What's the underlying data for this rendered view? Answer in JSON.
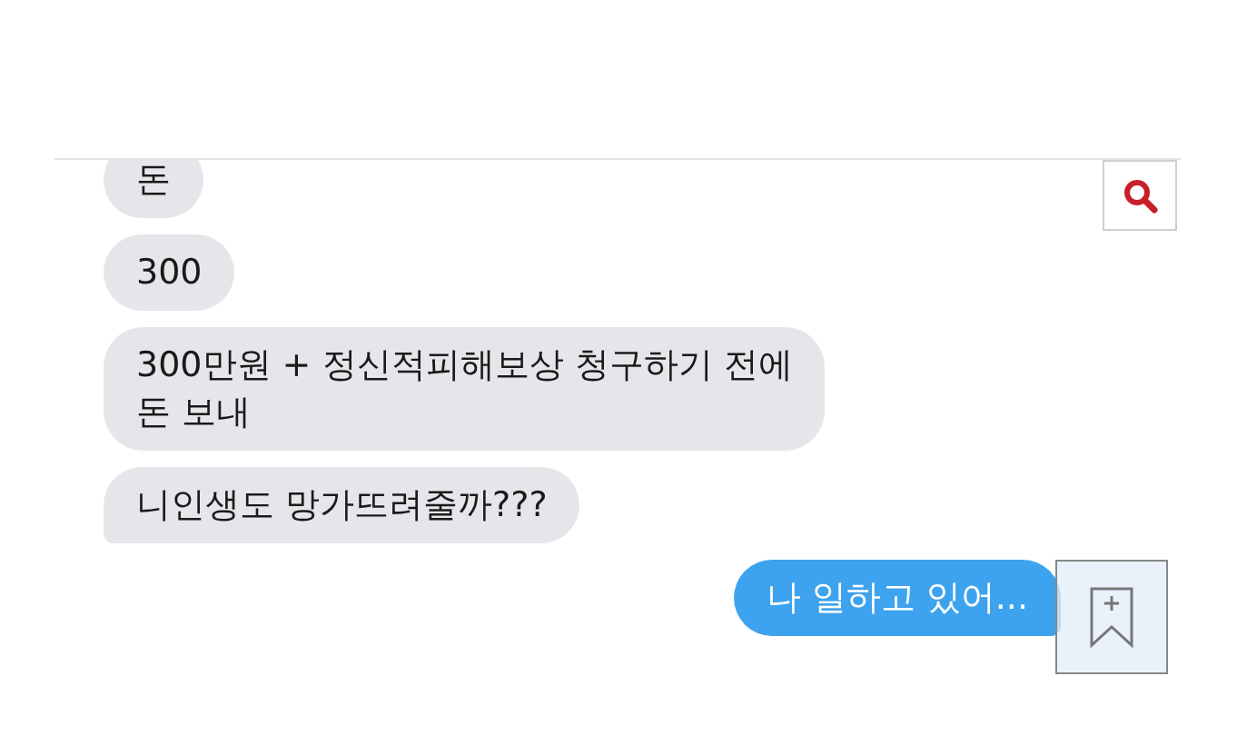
{
  "messages": [
    {
      "text": "돈",
      "kind": "received",
      "tail": false
    },
    {
      "text": "300",
      "kind": "received",
      "tail": false
    },
    {
      "text": "300만원 + 정신적피해보상 청구하기 전에\n돈 보내",
      "kind": "received",
      "tail": false
    },
    {
      "text": "니인생도 망가뜨려줄까???",
      "kind": "received",
      "tail": true
    },
    {
      "text": "나 일하고 있어...",
      "kind": "sent",
      "tail": true
    }
  ]
}
